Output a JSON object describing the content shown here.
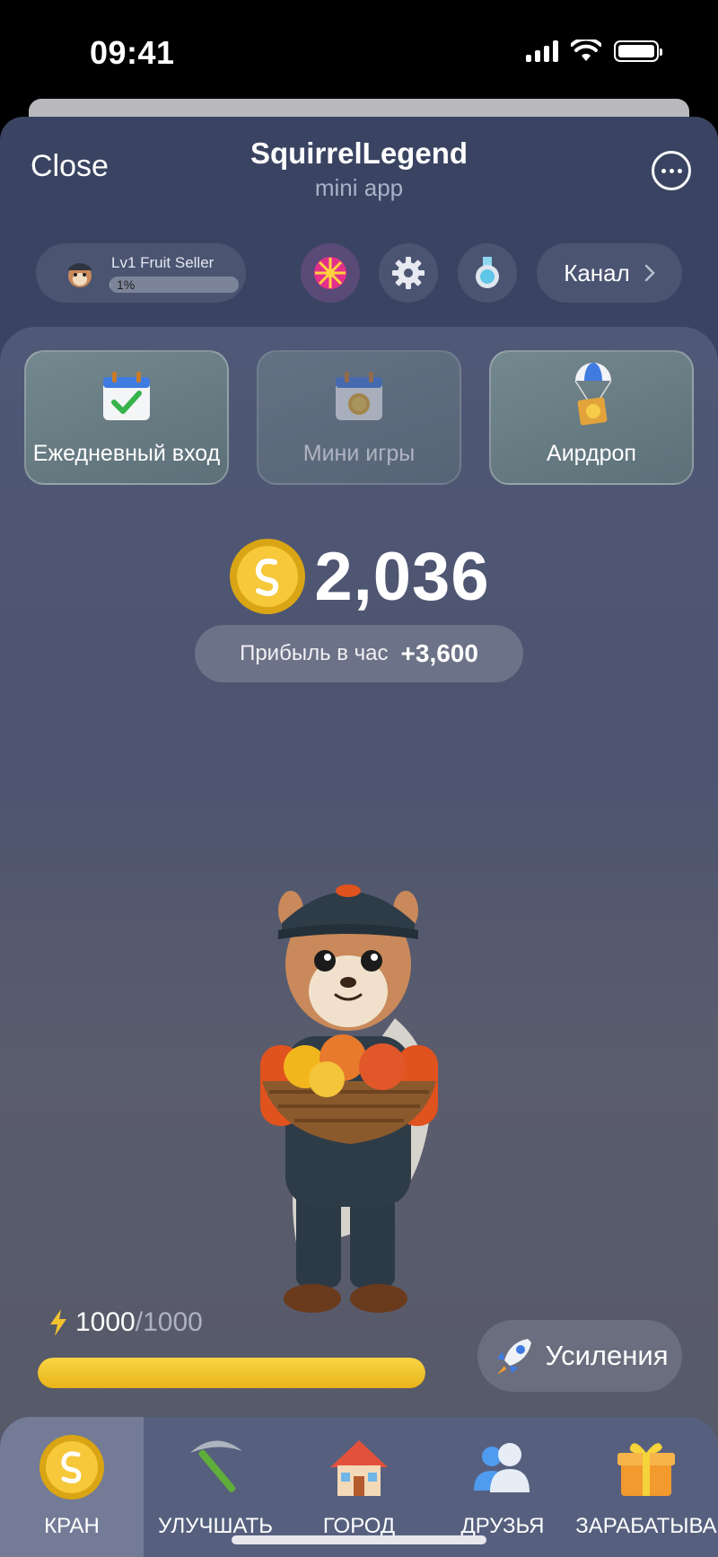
{
  "status_bar": {
    "time": "09:41"
  },
  "header": {
    "close_label": "Close",
    "title": "SquirrelLegend",
    "subtitle": "mini app"
  },
  "profile": {
    "level_title": "Lv1 Fruit Seller",
    "progress_text": "1%",
    "progress_fraction": 0.01
  },
  "channel_button": {
    "label": "Канал"
  },
  "features": [
    {
      "label": "Ежедневный вход",
      "icon": "calendar-check-icon"
    },
    {
      "label": "Мини игры",
      "icon": "calendar-coin-icon",
      "disabled": true
    },
    {
      "label": "Аирдроп",
      "icon": "parachute-box-icon"
    }
  ],
  "balance": {
    "value": "2,036"
  },
  "profit": {
    "label": "Прибыль в час",
    "value": "+3,600"
  },
  "energy": {
    "current": "1000",
    "max": "/1000",
    "fraction": 1.0
  },
  "boost": {
    "label": "Усиления"
  },
  "nav": [
    {
      "label": "КРАН",
      "icon": "coin-icon",
      "active": true
    },
    {
      "label": "УЛУЧШАТЬ",
      "icon": "pickaxe-icon"
    },
    {
      "label": "ГОРОД",
      "icon": "house-icon"
    },
    {
      "label": "ДРУЗЬЯ",
      "icon": "friends-icon"
    },
    {
      "label": "ЗАРАБАТЫВА",
      "icon": "gift-icon"
    }
  ],
  "colors": {
    "accent_yellow": "#f2c230",
    "panel": "#3a4462",
    "nav_active": "#737b97"
  }
}
